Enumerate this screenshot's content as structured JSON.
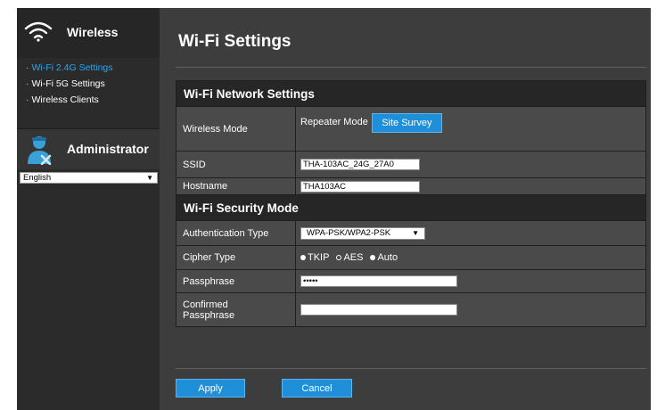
{
  "sidebar": {
    "title": "Wireless",
    "items": [
      {
        "label": "Wi-Fi 2.4G Settings",
        "active": true
      },
      {
        "label": "Wi-Fi 5G Settings",
        "active": false
      },
      {
        "label": "Wireless Clients",
        "active": false
      }
    ],
    "admin_label": "Administrator",
    "language": "English"
  },
  "main": {
    "title": "Wi-Fi Settings",
    "network_section": "Wi-Fi Network Settings",
    "wireless_mode": {
      "label": "Wireless Mode",
      "value": "Repeater Mode",
      "button": "Site Survey"
    },
    "ssid": {
      "label": "SSID",
      "value": "THA-103AC_24G_27A0"
    },
    "hostname": {
      "label": "Hostname",
      "value": "THA103AC"
    },
    "security_section": "Wi-Fi Security Mode",
    "auth_type": {
      "label": "Authentication Type",
      "value": "WPA-PSK/WPA2-PSK"
    },
    "cipher_type": {
      "label": "Cipher Type",
      "options": [
        "TKIP",
        "AES",
        "Auto"
      ]
    },
    "passphrase": {
      "label": "Passphrase",
      "value": "•••••"
    },
    "confirmed_passphrase": {
      "label_line1": "Confirmed",
      "label_line2": "Passphrase",
      "value": ""
    },
    "apply_label": "Apply",
    "cancel_label": "Cancel"
  },
  "colors": {
    "accent": "#1e8fd8",
    "active_link": "#2fa3e8",
    "panel": "#3d3d3d",
    "section_header": "#262626"
  },
  "icons": [
    "wifi-icon",
    "admin-icon",
    "chevron-down-icon"
  ]
}
